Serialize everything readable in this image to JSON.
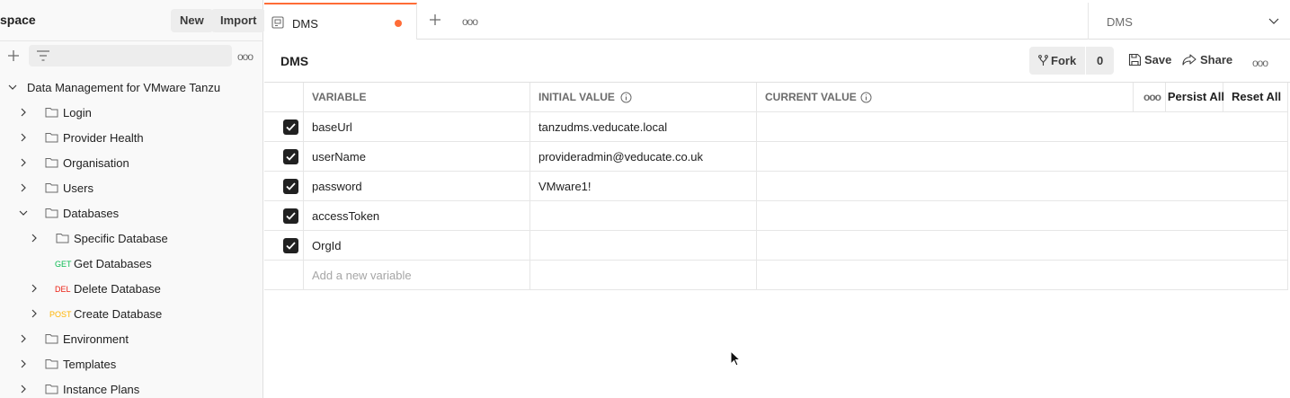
{
  "sidebar": {
    "workspace_title": "space",
    "new_label": "New",
    "import_label": "Import",
    "collection": {
      "name": "Data Management for VMware Tanzu",
      "items": [
        {
          "label": "Login",
          "type": "folder",
          "expanded": false
        },
        {
          "label": "Provider Health",
          "type": "folder",
          "expanded": false
        },
        {
          "label": "Organisation",
          "type": "folder",
          "expanded": false
        },
        {
          "label": "Users",
          "type": "folder",
          "expanded": false
        },
        {
          "label": "Databases",
          "type": "folder",
          "expanded": true
        },
        {
          "label": "Specific Database",
          "type": "folder",
          "expanded": false
        },
        {
          "label": "Get Databases",
          "type": "request",
          "method": "GET",
          "method_color": "#0cbb52"
        },
        {
          "label": "Delete Database",
          "type": "request",
          "method": "DEL",
          "method_color": "#eb2013"
        },
        {
          "label": "Create Database",
          "type": "request",
          "method": "POST",
          "method_color": "#ffb400"
        },
        {
          "label": "Environment",
          "type": "folder",
          "expanded": false
        },
        {
          "label": "Templates",
          "type": "folder",
          "expanded": false
        },
        {
          "label": "Instance Plans",
          "type": "folder",
          "expanded": false
        }
      ]
    }
  },
  "tabs": {
    "active_label": "DMS",
    "environment_selected": "DMS"
  },
  "header": {
    "title": "DMS",
    "fork_label": "Fork",
    "fork_count": "0",
    "save_label": "Save",
    "share_label": "Share"
  },
  "table": {
    "columns": {
      "variable": "VARIABLE",
      "initial": "INITIAL VALUE",
      "current": "CURRENT VALUE",
      "persist_all": "Persist All",
      "reset_all": "Reset All"
    },
    "rows": [
      {
        "variable": "baseUrl",
        "initial": "tanzudms.veducate.local",
        "current": "",
        "enabled": true
      },
      {
        "variable": "userName",
        "initial": "provideradmin@veducate.co.uk",
        "current": "",
        "enabled": true
      },
      {
        "variable": "password",
        "initial": "VMware1!",
        "current": "",
        "enabled": true
      },
      {
        "variable": "accessToken",
        "initial": "",
        "current": "",
        "enabled": true
      },
      {
        "variable": "OrgId",
        "initial": "",
        "current": "",
        "enabled": true
      }
    ],
    "add_placeholder": "Add a new variable"
  },
  "colors": {
    "accent": "#ff6c37"
  }
}
